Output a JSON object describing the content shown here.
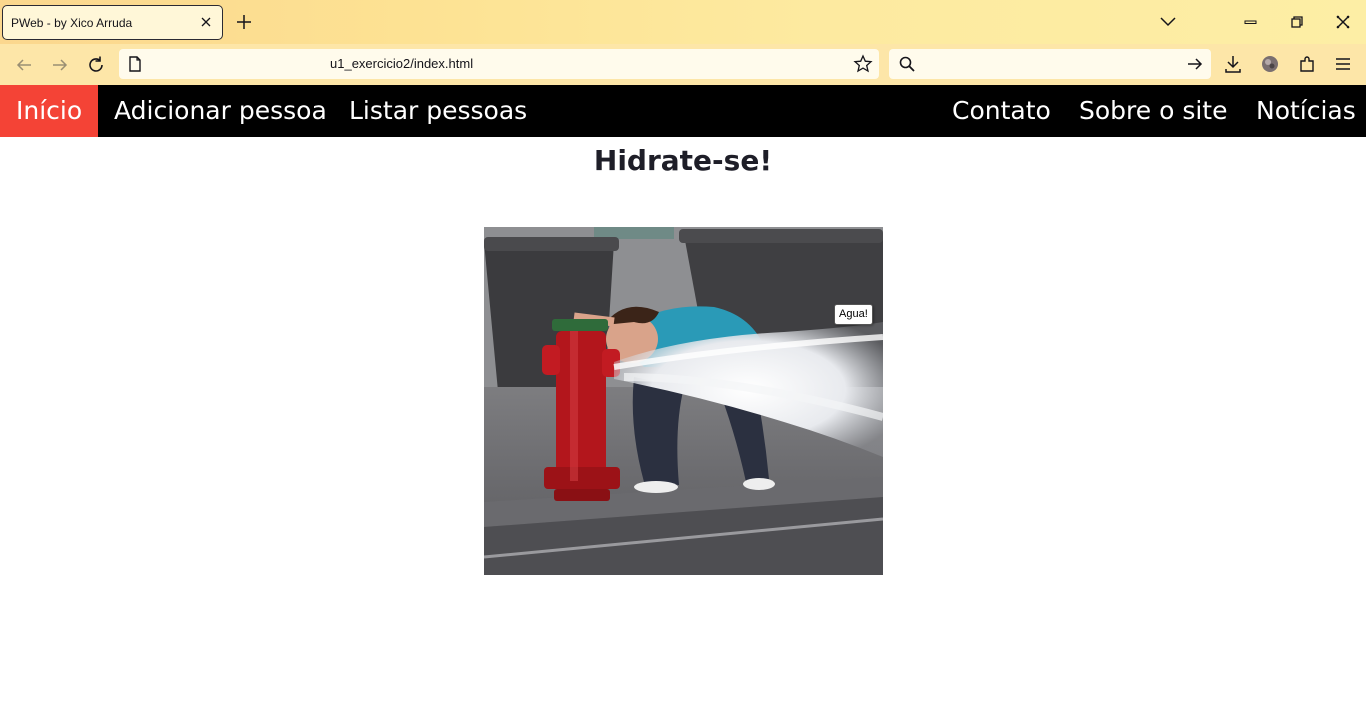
{
  "browser": {
    "tab_title": "PWeb - by Xico Arruda",
    "url": "u1_exercicio2/index.html"
  },
  "site_nav": {
    "left": [
      {
        "label": "Início",
        "active": true
      },
      {
        "label": "Adicionar pessoa",
        "active": false
      },
      {
        "label": "Listar pessoas",
        "active": false
      }
    ],
    "right": [
      {
        "label": "Contato"
      },
      {
        "label": "Sobre o site"
      },
      {
        "label": "Notícias"
      }
    ]
  },
  "page": {
    "title": "Hidrate-se!",
    "image_tooltip": "Agua!"
  },
  "colors": {
    "nav_background": "#000000",
    "nav_active": "#f44336",
    "tabbar_background": "#fde293"
  }
}
